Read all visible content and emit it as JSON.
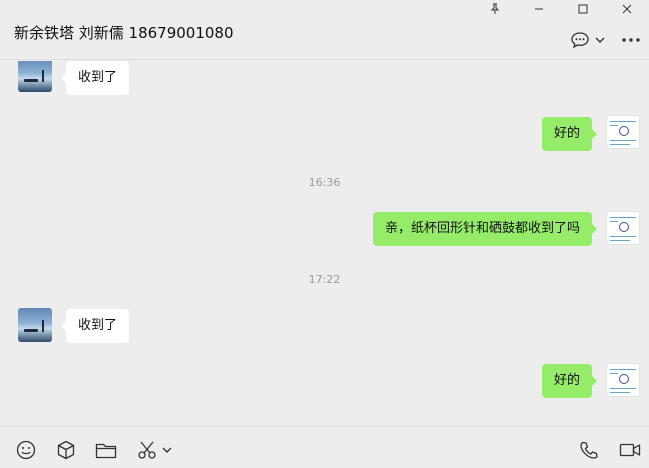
{
  "header": {
    "title": "新余铁塔 刘新儒 18679001080"
  },
  "window_controls": [
    "pin-icon",
    "minimize-icon",
    "maximize-icon",
    "close-icon"
  ],
  "header_actions": [
    "chat-bubble-icon",
    "chevron-down-icon",
    "more-icon"
  ],
  "messages": [
    {
      "direction": "in",
      "text": "收到了"
    },
    {
      "direction": "out",
      "text": "好的"
    },
    {
      "type": "time",
      "text": "16:36"
    },
    {
      "direction": "out",
      "text": "亲，纸杯回形针和硒鼓都收到了吗"
    },
    {
      "type": "time",
      "text": "17:22"
    },
    {
      "direction": "in",
      "text": "收到了"
    },
    {
      "direction": "out",
      "text": "好的"
    }
  ],
  "toolbar": {
    "left": [
      "emoji-icon",
      "package-icon",
      "folder-icon",
      "scissors-icon",
      "chevron-down-icon"
    ],
    "right": [
      "phone-icon",
      "video-icon"
    ]
  },
  "colors": {
    "outgoing_bubble": "#95ec69",
    "incoming_bubble": "#ffffff",
    "background": "#ededed"
  }
}
